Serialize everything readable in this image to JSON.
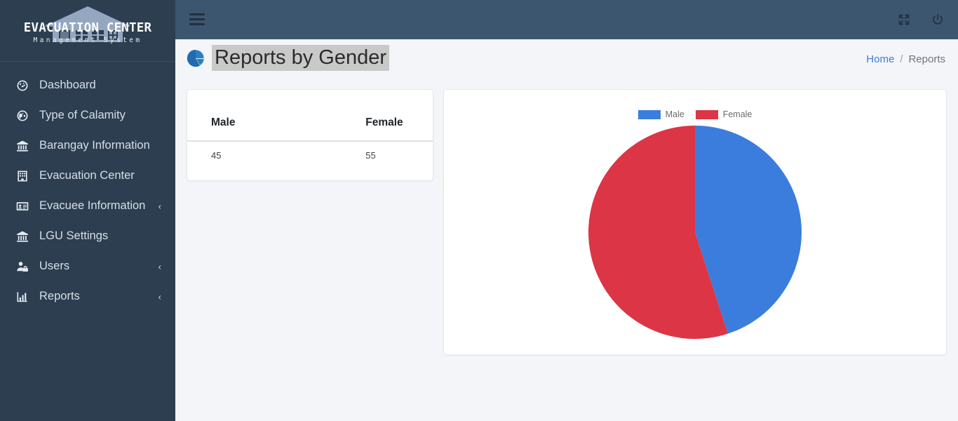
{
  "brand": {
    "title": "EVACUATION CENTER",
    "subtitle": "Management System",
    "icon": "house-icon"
  },
  "sidebar": {
    "items": [
      {
        "label": "Dashboard",
        "icon": "dashboard-gauge-icon",
        "caret": ""
      },
      {
        "label": "Type of Calamity",
        "icon": "globe-icon",
        "caret": ""
      },
      {
        "label": "Barangay Information",
        "icon": "bank-building-icon",
        "caret": ""
      },
      {
        "label": "Evacuation Center",
        "icon": "building-icon",
        "caret": ""
      },
      {
        "label": "Evacuee Information",
        "icon": "id-card-icon",
        "caret": "‹"
      },
      {
        "label": "LGU Settings",
        "icon": "bank-building-icon",
        "caret": ""
      },
      {
        "label": "Users",
        "icon": "user-lock-icon",
        "caret": "‹"
      },
      {
        "label": "Reports",
        "icon": "bar-chart-icon",
        "caret": "‹"
      }
    ]
  },
  "topbar": {
    "menu_toggle_icon": "hamburger-icon",
    "fullscreen_icon": "expand-arrows-icon",
    "power_icon": "power-icon"
  },
  "page": {
    "title": "Reports by Gender",
    "title_icon": "pie-chart-icon",
    "breadcrumb": {
      "home": "Home",
      "separator": "/",
      "current": "Reports"
    }
  },
  "table": {
    "headers": [
      "Male",
      "Female"
    ],
    "rows": [
      [
        "45",
        "55"
      ]
    ]
  },
  "colors": {
    "male": "#3b7ddd",
    "female": "#dc3545",
    "sidebar": "#2c3e50",
    "topbar": "#3d5670",
    "content_bg": "#f4f5f9",
    "link": "#3b7ddd"
  },
  "chart_data": {
    "type": "pie",
    "title": "",
    "categories": [
      "Male",
      "Female"
    ],
    "values": [
      45,
      55
    ],
    "colors": [
      "#3b7ddd",
      "#dc3545"
    ],
    "legend": [
      "Male",
      "Female"
    ],
    "legend_position": "top",
    "start_angle": 0,
    "direction": "clockwise",
    "total": 100
  }
}
